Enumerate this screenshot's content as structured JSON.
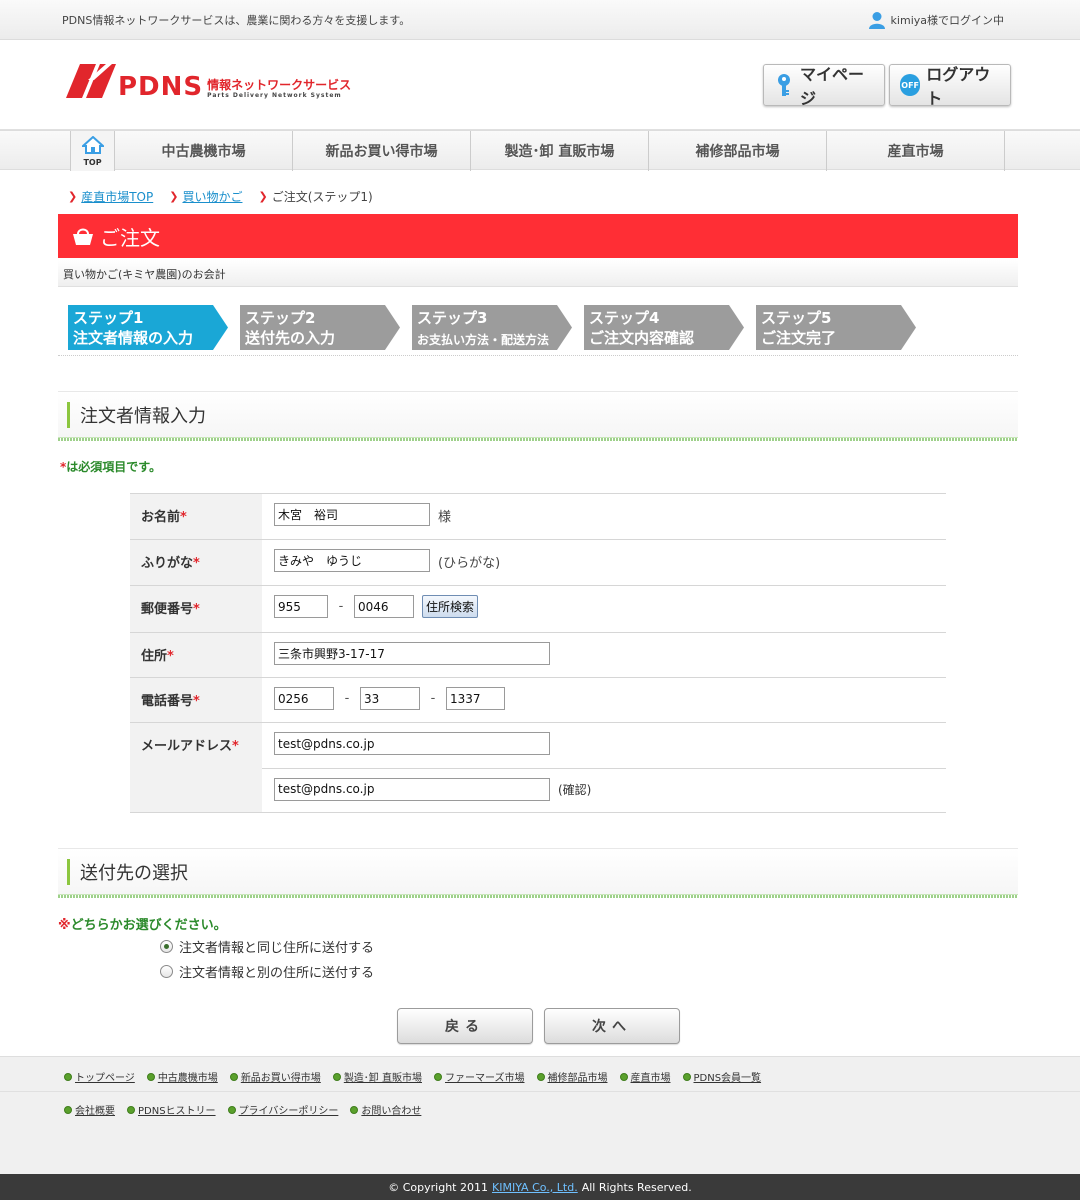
{
  "topbar": {
    "tagline": "PDNS情報ネットワークサービスは、農業に関わる方々を支援します。",
    "login_status": "kimiya様でログイン中"
  },
  "logo": {
    "mark_text": "PDNS",
    "jp_text": "情報ネットワークサービス",
    "en_text": "Parts Delivery Network System"
  },
  "header_buttons": {
    "mypage": "マイページ",
    "logout_badge": "OFF",
    "logout": "ログアウト"
  },
  "nav": {
    "top_label": "TOP",
    "items": [
      "中古農機市場",
      "新品お買い得市場",
      "製造･卸 直販市場",
      "補修部品市場",
      "産直市場"
    ]
  },
  "breadcrumb": {
    "items": [
      {
        "label": "産直市場TOP",
        "link": true
      },
      {
        "label": "買い物かご",
        "link": true
      },
      {
        "label": "ご注文(ステップ1)",
        "link": false
      }
    ]
  },
  "page": {
    "title": "ご注文",
    "subtitle": "買い物かご(キミヤ農園)のお会計"
  },
  "steps": [
    {
      "line1": "ステップ1",
      "line2": "注文者情報の入力",
      "active": true
    },
    {
      "line1": "ステップ2",
      "line2": "送付先の入力",
      "active": false
    },
    {
      "line1": "ステップ3",
      "line2": "お支払い方法・配送方法",
      "active": false
    },
    {
      "line1": "ステップ4",
      "line2": "ご注文内容確認",
      "active": false
    },
    {
      "line1": "ステップ5",
      "line2": "ご注文完了",
      "active": false
    }
  ],
  "section1": {
    "heading": "注文者情報入力",
    "required_note": "は必須項目です。",
    "required_mark": "*"
  },
  "form": {
    "name": {
      "label": "お名前",
      "value": "木宮　裕司",
      "suffix": "様"
    },
    "furigana": {
      "label": "ふりがな",
      "value": "きみや　ゆうじ",
      "suffix": "(ひらがな)"
    },
    "postal": {
      "label": "郵便番号",
      "value1": "955",
      "sep": "-",
      "value2": "0046",
      "search_button": "住所検索"
    },
    "address": {
      "label": "住所",
      "value": "三条市興野3-17-17"
    },
    "phone": {
      "label": "電話番号",
      "value1": "0256",
      "value2": "33",
      "value3": "1337",
      "sep": "-"
    },
    "email": {
      "label": "メールアドレス",
      "value": "test@pdns.co.jp",
      "confirm_value": "test@pdns.co.jp",
      "confirm_suffix": "(確認)"
    }
  },
  "section2": {
    "heading": "送付先の選択",
    "note_mark": "※",
    "note": "どちらかお選びください。",
    "options": [
      {
        "label": "注文者情報と同じ住所に送付する",
        "selected": true
      },
      {
        "label": "注文者情報と別の住所に送付する",
        "selected": false
      }
    ]
  },
  "buttons": {
    "back": "戻る",
    "next": "次へ"
  },
  "footer": {
    "links1": [
      "トップページ",
      "中古農機市場",
      "新品お買い得市場",
      "製造･卸 直販市場",
      "ファーマーズ市場",
      "補修部品市場",
      "産直市場",
      "PDNS会員一覧"
    ],
    "links2": [
      "会社概要",
      "PDNSヒストリー",
      "プライバシーポリシー",
      "お問い合わせ"
    ],
    "copyright_prefix": "© Copyright 2011",
    "copyright_company": "KIMIYA Co., Ltd.",
    "copyright_suffix": "All Rights Reserved."
  },
  "colors": {
    "brand_red": "#ff2e35",
    "step_active": "#1aa7d6",
    "step_inactive": "#9c9c9c",
    "accent_green": "#8cc63f"
  }
}
